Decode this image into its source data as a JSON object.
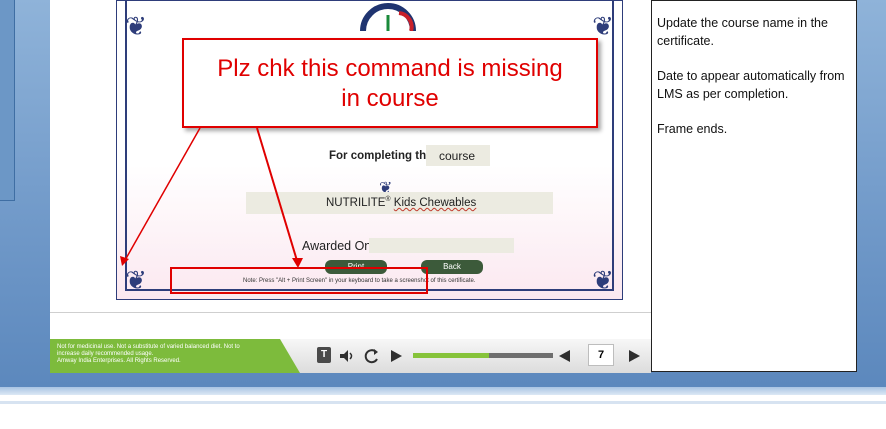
{
  "callout": {
    "text_line1": "Plz chk this command is missing",
    "text_line2": "in course"
  },
  "certificate": {
    "completing_label": "For completing the",
    "course_field_value": "course",
    "product_name": "NUTRILITE",
    "product_superscript": "®",
    "product_suffix": "Kids Chewables",
    "awarded_label": "Awarded On",
    "awarded_value": "",
    "print_button_label": "Print",
    "back_button_label": "Back",
    "note_text": "Note: Press \"Alt + Print Screen\" in your keyboard to take a screenshot of this certificate."
  },
  "player": {
    "disclaimer_lines": [
      "Not for medicinal use. Not a substitute of varied balanced diet. Not to",
      "increase daily recommended usage.",
      "Amway India Enterprises. All Rights Reserved."
    ],
    "transcript_label": "T",
    "page_number": "7",
    "progress_fraction": 0.54,
    "icons": [
      "transcript-icon",
      "volume-icon",
      "replay-icon",
      "play-icon",
      "previous-icon",
      "next-icon"
    ]
  },
  "notes": {
    "paragraphs": [
      "Update the course name in the certificate.",
      "Date to appear automatically from LMS as per completion.",
      "Frame ends."
    ]
  },
  "colors": {
    "callout_red": "#e00000",
    "disclaimer_green": "#7dbb3c",
    "cert_border_navy": "#2e3d7a"
  }
}
